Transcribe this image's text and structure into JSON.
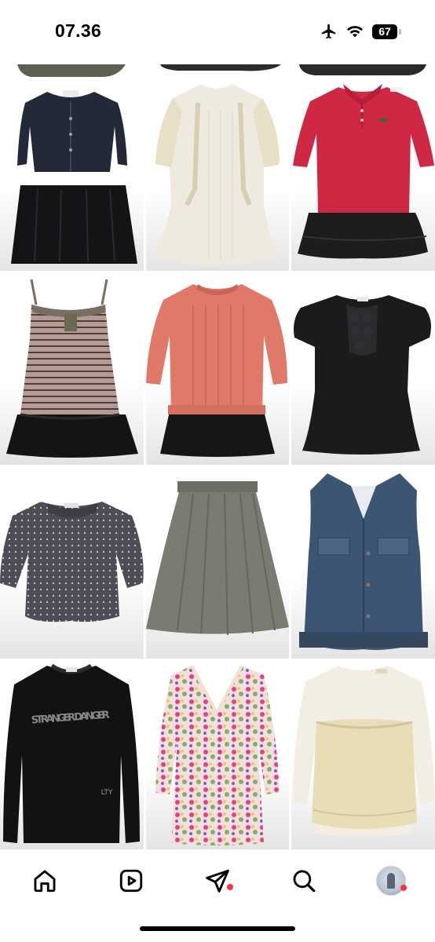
{
  "status_bar": {
    "time": "07.36",
    "battery": "67",
    "icons": [
      "airplane-icon",
      "wifi-icon",
      "battery-icon"
    ]
  },
  "grid": {
    "columns": 3,
    "items": [
      {
        "name": "post-partial-1",
        "kind": "partial"
      },
      {
        "name": "post-partial-2",
        "kind": "partial"
      },
      {
        "name": "post-partial-3",
        "kind": "partial"
      },
      {
        "name": "post-navy-cardigan-dress",
        "kind": "cardigan-dress"
      },
      {
        "name": "post-cream-lace-dress",
        "kind": "lace-dress"
      },
      {
        "name": "post-red-polo-dress",
        "kind": "polo-dress"
      },
      {
        "name": "post-striped-cami-dress",
        "kind": "cami-dress"
      },
      {
        "name": "post-coral-sweater-dress",
        "kind": "sweater-dress"
      },
      {
        "name": "post-black-ruffle-top",
        "kind": "ruffle-top"
      },
      {
        "name": "post-grey-dotted-blouse",
        "kind": "dotted-blouse"
      },
      {
        "name": "post-grey-skirt",
        "kind": "skirt"
      },
      {
        "name": "post-denim-vest",
        "kind": "denim-vest"
      },
      {
        "name": "post-black-graphic-sweater",
        "kind": "graphic-sweater",
        "print": "STRANGER DANGER",
        "tag": "LTY"
      },
      {
        "name": "post-floral-dress",
        "kind": "floral-dress"
      },
      {
        "name": "post-cream-lace-top",
        "kind": "lace-top"
      }
    ]
  },
  "bottom_nav": {
    "items": [
      {
        "name": "home-icon"
      },
      {
        "name": "reels-icon"
      },
      {
        "name": "send-icon"
      },
      {
        "name": "search-icon"
      },
      {
        "name": "profile-avatar"
      }
    ],
    "notification_color": "#ff3040"
  }
}
